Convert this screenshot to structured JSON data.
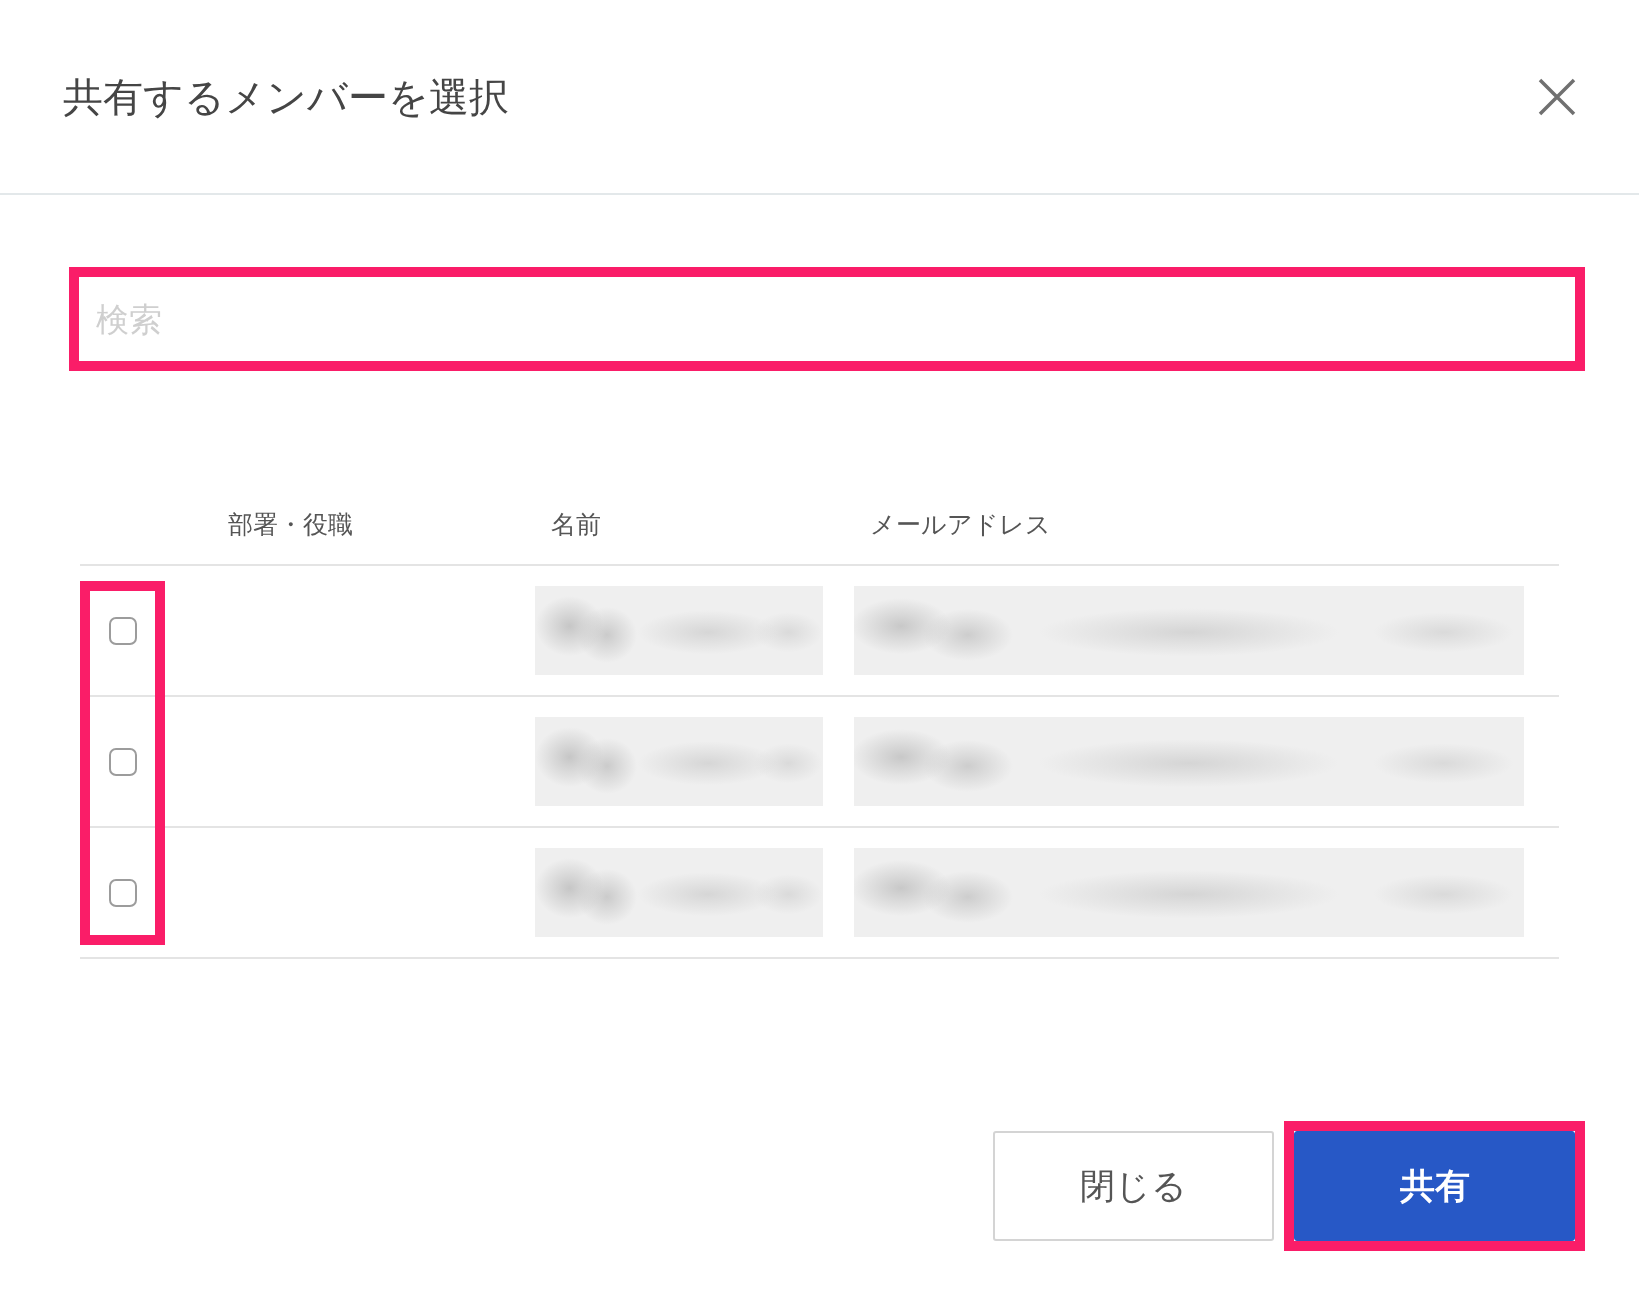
{
  "dialog": {
    "title": "共有するメンバーを選択"
  },
  "search": {
    "placeholder": "検索",
    "highlighted": true
  },
  "table": {
    "columns": [
      "部署・役職",
      "名前",
      "メールアドレス"
    ],
    "checkbox_column_highlighted": true,
    "rows": [
      {
        "checked": false
      },
      {
        "checked": false
      },
      {
        "checked": false
      }
    ]
  },
  "buttons": [
    {
      "label": "閉じる",
      "kind": "secondary",
      "highlighted": false
    },
    {
      "label": "共有",
      "kind": "primary",
      "highlighted": true
    }
  ]
}
